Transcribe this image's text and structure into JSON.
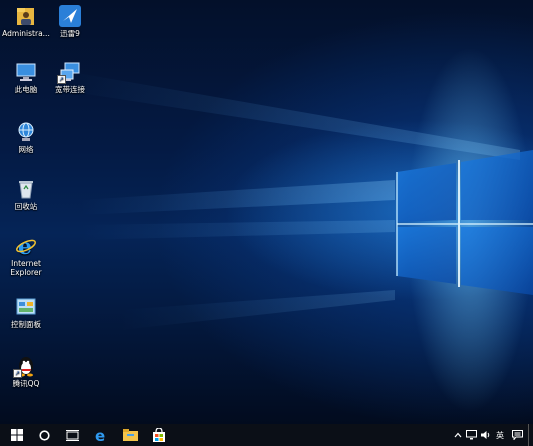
{
  "desktop_icons": [
    {
      "id": "admin",
      "label": "Administra...",
      "icon": "user-folder-icon"
    },
    {
      "id": "xunlei",
      "label": "迅雷9",
      "icon": "xunlei-bird-icon"
    },
    {
      "id": "pc",
      "label": "此电脑",
      "icon": "computer-icon"
    },
    {
      "id": "broadband",
      "label": "宽带连接",
      "icon": "broadband-connection-icon"
    },
    {
      "id": "network",
      "label": "网络",
      "icon": "network-globe-icon"
    },
    {
      "id": "recycle",
      "label": "回收站",
      "icon": "recycle-bin-icon"
    },
    {
      "id": "ie",
      "label": "Internet Explorer",
      "icon": "internet-explorer-icon"
    },
    {
      "id": "control",
      "label": "控制面板",
      "icon": "control-panel-icon"
    },
    {
      "id": "qq",
      "label": "腾讯QQ",
      "icon": "qq-penguin-icon"
    }
  ],
  "taskbar": {
    "pinned": [
      "start-windows-icon",
      "cortana-circle-icon",
      "task-view-icon",
      "edge-icon",
      "file-explorer-icon",
      "store-icon"
    ],
    "tray": {
      "language": "英"
    }
  },
  "colors": {
    "accent": "#1e90ff",
    "taskbar": "#0b0f17"
  }
}
